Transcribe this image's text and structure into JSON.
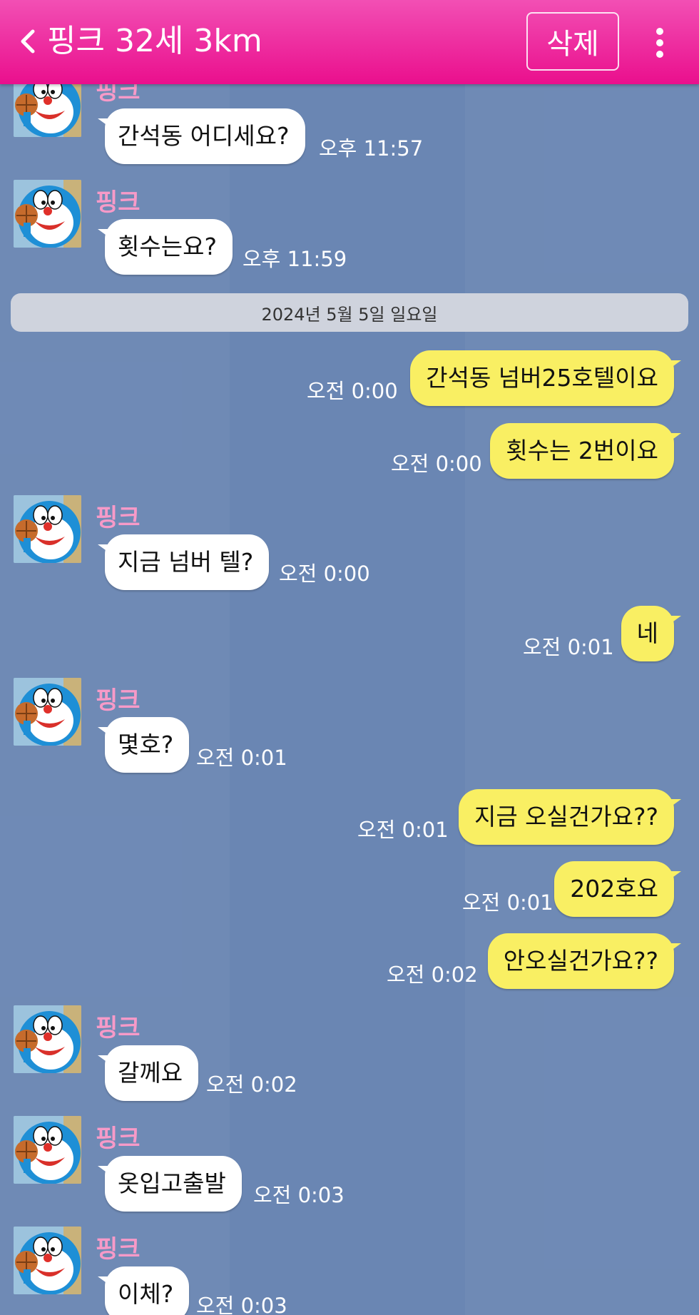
{
  "header": {
    "title": "핑크 32세 3km",
    "delete_label": "삭제",
    "back_icon": "chevron-left-icon",
    "more_icon": "more-vertical-icon",
    "colors": {
      "top": "#f24fb4",
      "bottom": "#ea0f8d"
    }
  },
  "date_divider": "2024년 5월 5일 일요일",
  "messages": [
    {
      "direction": "incoming",
      "sender": "핑크",
      "text": "간석동 어디세요?",
      "time": "오후 11:57"
    },
    {
      "direction": "incoming",
      "sender": "핑크",
      "text": "횟수는요?",
      "time": "오후 11:59"
    },
    {
      "direction": "outgoing",
      "text": "간석동 넘버25호텔이요",
      "time": "오전 0:00"
    },
    {
      "direction": "outgoing",
      "text": "횟수는 2번이요",
      "time": "오전 0:00"
    },
    {
      "direction": "incoming",
      "sender": "핑크",
      "text": "지금 넘버 텔?",
      "time": "오전 0:00"
    },
    {
      "direction": "outgoing",
      "text": "네",
      "time": "오전 0:01"
    },
    {
      "direction": "incoming",
      "sender": "핑크",
      "text": "몇호?",
      "time": "오전 0:01"
    },
    {
      "direction": "outgoing",
      "text": "지금 오실건가요??",
      "time": "오전 0:01"
    },
    {
      "direction": "outgoing",
      "text": "202호요",
      "time": "오전 0:01"
    },
    {
      "direction": "outgoing",
      "text": "안오실건가요??",
      "time": "오전 0:02"
    },
    {
      "direction": "incoming",
      "sender": "핑크",
      "text": "갈께요",
      "time": "오전 0:02"
    },
    {
      "direction": "incoming",
      "sender": "핑크",
      "text": "옷입고출발",
      "time": "오전 0:03"
    },
    {
      "direction": "incoming",
      "sender": "핑크",
      "text": "이체?",
      "time": "오전 0:03"
    }
  ]
}
